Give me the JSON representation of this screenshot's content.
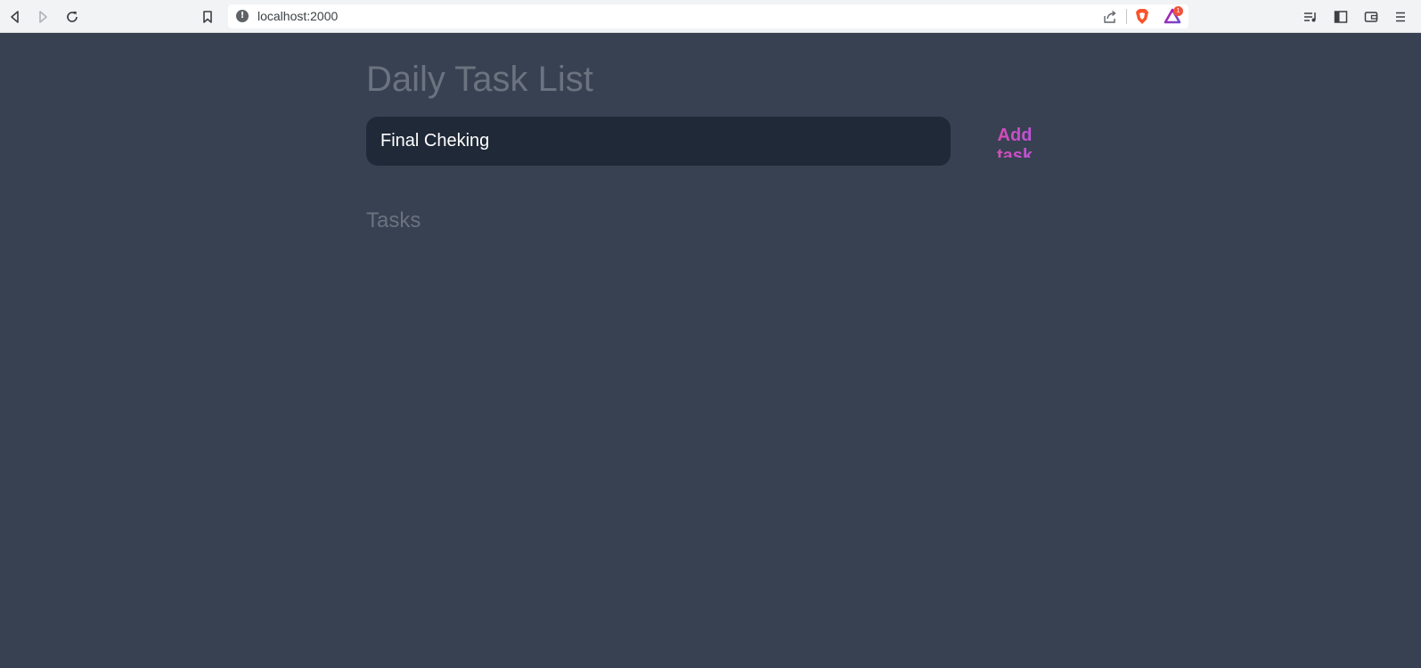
{
  "browser": {
    "url": "localhost:2000",
    "rewards_badge": "1",
    "icons": {
      "back": "back-arrow-icon",
      "forward": "forward-arrow-icon",
      "reload": "reload-icon",
      "bookmark": "bookmark-icon",
      "site_info": "info-icon",
      "share": "share-icon",
      "shields": "brave-shield-icon",
      "rewards": "brave-rewards-icon",
      "playlist": "playlist-icon",
      "sidebar": "sidebar-icon",
      "wallet": "wallet-icon",
      "menu": "menu-icon"
    }
  },
  "page": {
    "title": "Daily Task List",
    "task_input_value": "Final Cheking",
    "add_button_label": "Add task",
    "tasks_heading": "Tasks",
    "colors": {
      "background": "#374151",
      "input_background": "#1f2937",
      "muted_text": "#6b7280",
      "gradient_start": "#ec4899",
      "gradient_end": "#a855f7"
    }
  }
}
